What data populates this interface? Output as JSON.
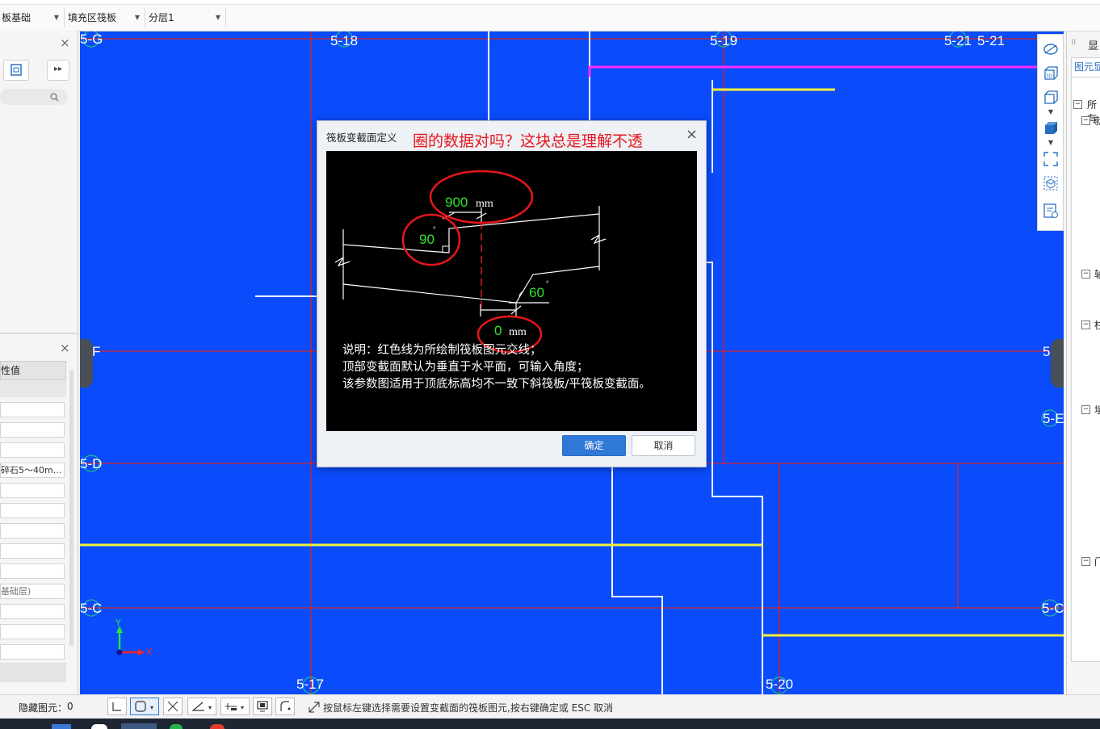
{
  "toolbar": {
    "combo1": "板基础",
    "combo2": "填充区筏板",
    "combo3": "分层1"
  },
  "left_panel": {
    "header_value": "性值",
    "field_concrete": "碎石5～40m...",
    "field_layer": "基础层)"
  },
  "canvas": {
    "axis_labels": [
      "5-G",
      "5-18",
      "5-19",
      "5-21",
      "5-21",
      "F",
      "5",
      "5-E",
      "5-D",
      "5-C",
      "5-C",
      "5-17",
      "5-20"
    ],
    "coord_y": "Y",
    "coord_x": "X"
  },
  "right_panel": {
    "title": "显",
    "tab": "图元显",
    "tree_item_all": "所有",
    "tree_items": [
      "就",
      "轴",
      "柱",
      "墙",
      "门"
    ]
  },
  "dialog": {
    "title": "筏板变截面定义",
    "annotation": "圈的数据对吗？这块总是理解不透",
    "diagram": {
      "top_width_value": "900",
      "top_width_unit": "mm",
      "top_angle_value": "90",
      "top_angle_unit": "°",
      "bottom_angle_value": "60",
      "bottom_angle_unit": "°",
      "bottom_width_value": "0",
      "bottom_width_unit": "mm",
      "description": [
        "说明：红色线为所绘制筏板图元交线；",
        "顶部变截面默认为垂直于水平面，可输入角度；",
        "该参数图适用于顶底标高均不一致下斜筏板/平筏板变截面。"
      ]
    },
    "ok_label": "确定",
    "cancel_label": "取消"
  },
  "statusbar": {
    "hidden_label": "隐藏图元：",
    "hidden_count": "0",
    "hint": "按鼠标左键选择需要设置变截面的筏板图元,按右键确定或 ESC 取消"
  },
  "colors": {
    "canvas_bg": "#0a4bfb",
    "grid_line": "#d2252b",
    "wall_yellow": "#f2f23a",
    "wall_magenta": "#ff2bff",
    "annotation_red": "#e8161b",
    "diagram_green": "#33e22f",
    "ok_button": "#2f78d6"
  }
}
